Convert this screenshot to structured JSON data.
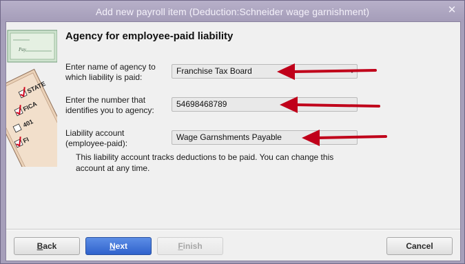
{
  "window": {
    "title": "Add new payroll item (Deduction:Schneider wage garnishment)"
  },
  "heading": "Agency for employee-paid liability",
  "agency": {
    "label_line1": "Enter name of agency to",
    "label_line2": "which liability is paid:",
    "value": "Franchise Tax Board"
  },
  "agency_number": {
    "label_line1": "Enter the number that",
    "label_line2": "identifies you to agency:",
    "value": "54698468789"
  },
  "liability_account": {
    "label_line1": "Liability account",
    "label_line2": "(employee-paid):",
    "value": "Wage Garnshments Payable"
  },
  "note": {
    "line1": "This liability account tracks deductions to be paid. You can change this",
    "line2": "account at any time."
  },
  "buttons": {
    "back": {
      "prefix": "",
      "underlined": "B",
      "rest": "ack"
    },
    "next": {
      "prefix": "",
      "underlined": "N",
      "rest": "ext"
    },
    "finish": {
      "prefix": "",
      "underlined": "F",
      "rest": "inish"
    },
    "cancel": "Cancel"
  },
  "art": {
    "tags": [
      "STATE",
      "FICA",
      "401",
      "FI"
    ],
    "check_word": "Pay"
  },
  "colors": {
    "window_frame": "#a69fba",
    "client_bg": "#f0f0f0",
    "primary_button": "#3a6fd8",
    "annotation_arrow": "#c0001a"
  }
}
